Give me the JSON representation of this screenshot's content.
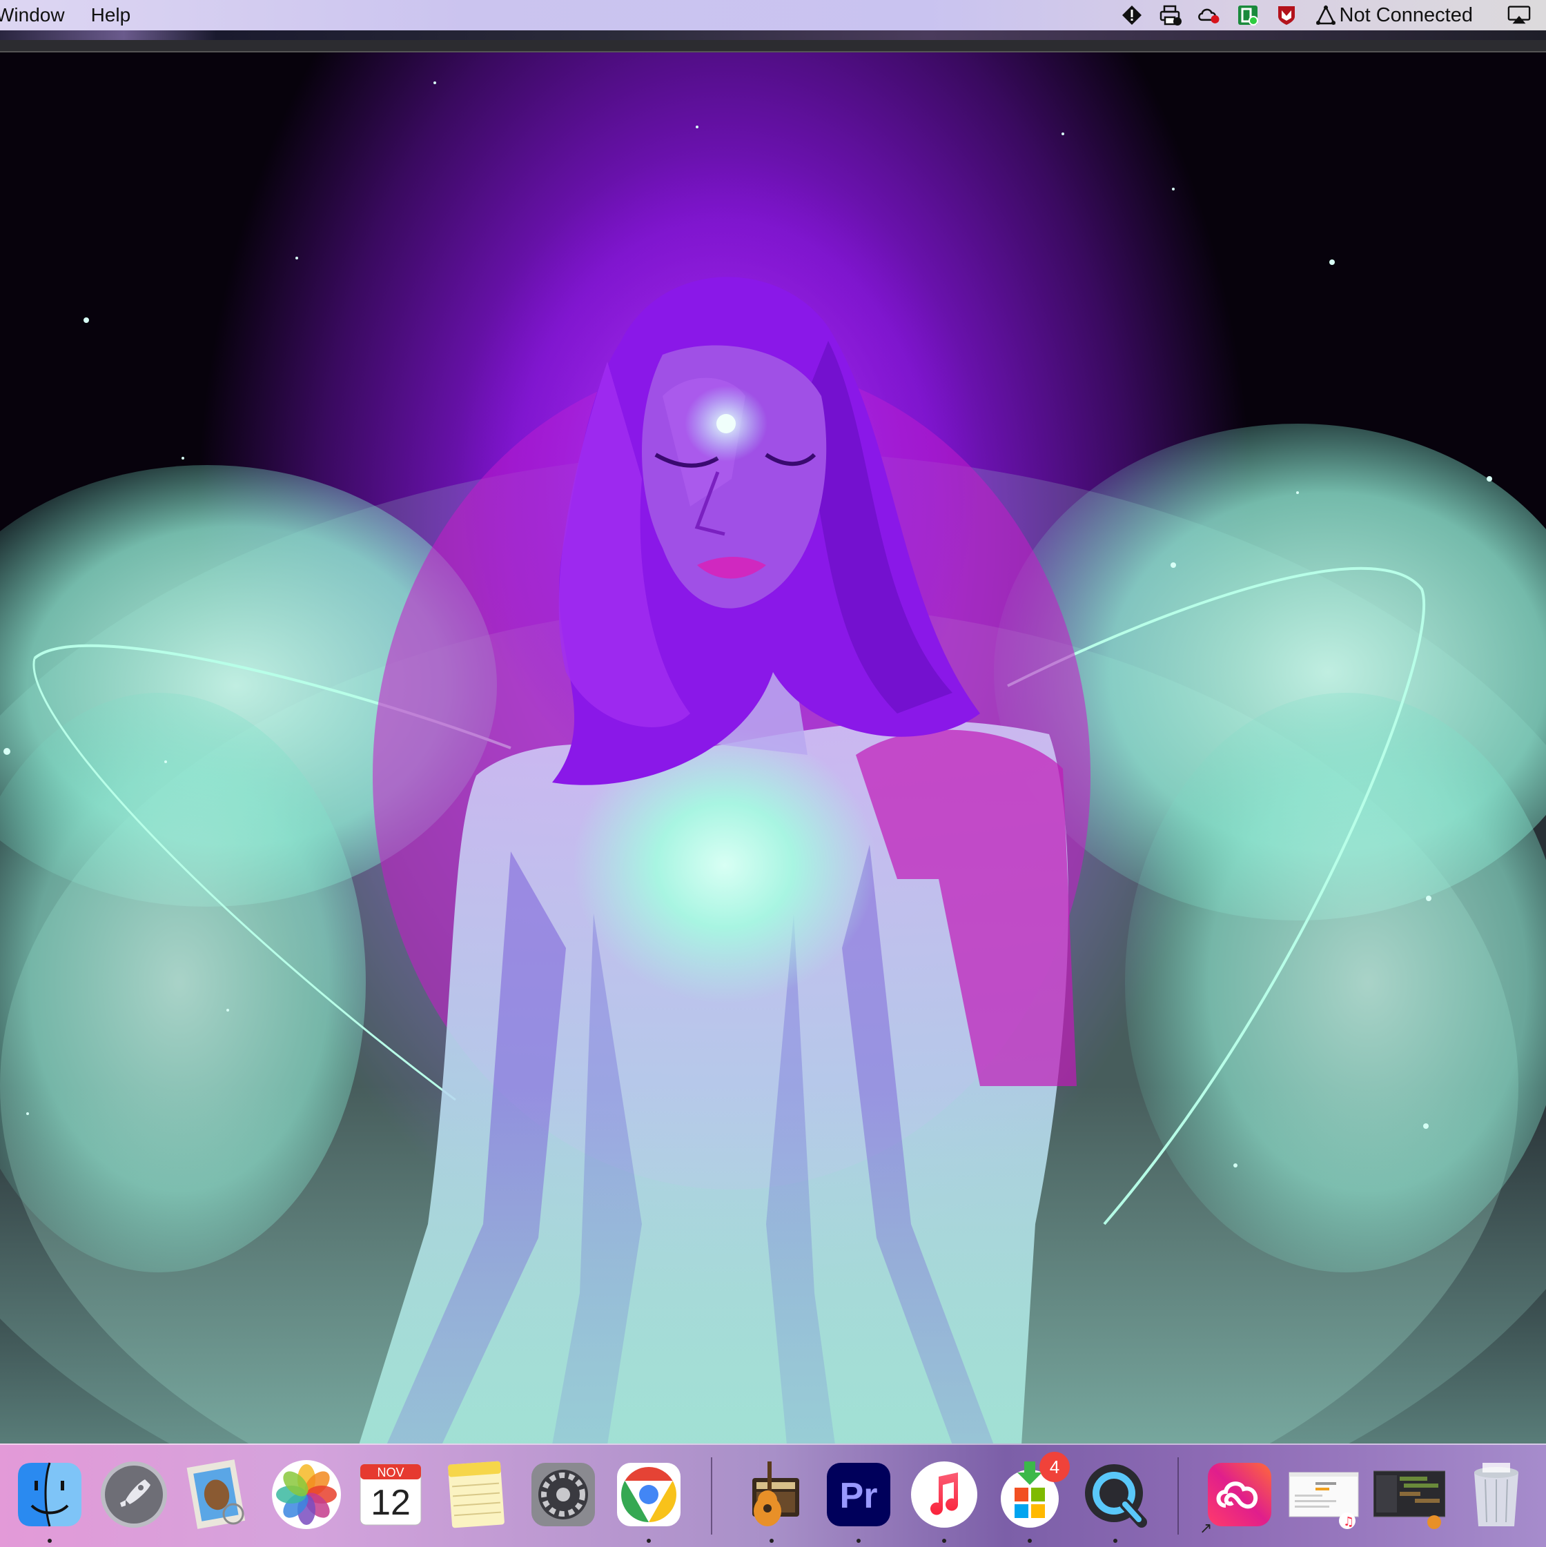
{
  "menubar": {
    "items": [
      "Window",
      "Help"
    ],
    "status": {
      "network_text": "Not Connected",
      "icons": [
        "alert-icon",
        "printer-icon",
        "creative-cloud-sync-icon",
        "app-green-icon",
        "mcafee-icon",
        "network-icon",
        "airplay-icon"
      ]
    }
  },
  "wallpaper": {
    "subject": "glowing-angel-figure"
  },
  "dock": {
    "apps": [
      {
        "name": "Finder",
        "icon": "finder-icon",
        "running": true
      },
      {
        "name": "Launchpad",
        "icon": "launchpad-icon",
        "running": false
      },
      {
        "name": "Mail",
        "icon": "mail-icon",
        "running": false
      },
      {
        "name": "Photos",
        "icon": "photos-icon",
        "running": false
      },
      {
        "name": "Calendar",
        "icon": "calendar-icon",
        "running": false,
        "month": "NOV",
        "day": "12"
      },
      {
        "name": "Notes",
        "icon": "notes-icon",
        "running": false
      },
      {
        "name": "System Preferences",
        "icon": "system-preferences-icon",
        "running": false
      },
      {
        "name": "Google Chrome",
        "icon": "chrome-icon",
        "running": true
      },
      {
        "name": "GarageBand",
        "icon": "garageband-icon",
        "running": true
      },
      {
        "name": "Adobe Premiere Pro",
        "icon": "premiere-icon",
        "running": true,
        "label": "Pr"
      },
      {
        "name": "Music",
        "icon": "music-icon",
        "running": true
      },
      {
        "name": "Microsoft Store",
        "icon": "msstore-icon",
        "running": true,
        "badge": "4"
      },
      {
        "name": "QuickTime Player",
        "icon": "quicktime-icon",
        "running": true
      },
      {
        "name": "Adobe Creative Cloud",
        "icon": "creative-cloud-icon",
        "running": false
      },
      {
        "name": "Document Window",
        "icon": "document-window-icon",
        "running": false
      },
      {
        "name": "Logic Window",
        "icon": "logic-window-icon",
        "running": false
      },
      {
        "name": "Trash",
        "icon": "trash-icon",
        "running": false
      }
    ]
  },
  "colors": {
    "menubar": "#cbc4ef",
    "glow_purple": "#9a18e0",
    "glow_cyan": "#9ff0dc",
    "badge_red": "#f0423a"
  }
}
